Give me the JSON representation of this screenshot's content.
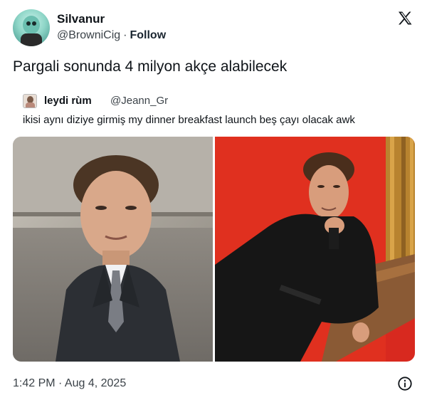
{
  "author": {
    "name": "Silvanur",
    "handle": "@BrowniCig",
    "separator": "·",
    "follow_label": "Follow"
  },
  "tweet": {
    "text": "Pargali sonunda 4 milyon akçe alabilecek"
  },
  "quoted_tweet": {
    "name": "leydi rùm",
    "handle": "@Jeann_Gr",
    "text": "ikisi aynı diziye girmiş my dinner breakfast launch beş çayı olacak awk"
  },
  "meta": {
    "timestamp": "1:42 PM · Aug 4, 2025"
  },
  "icons": {
    "logo": "x-logo-icon",
    "info": "info-icon"
  },
  "colors": {
    "text_primary": "#0f1419",
    "text_secondary": "#3b4248",
    "right_photo_background": "#d8291f"
  }
}
